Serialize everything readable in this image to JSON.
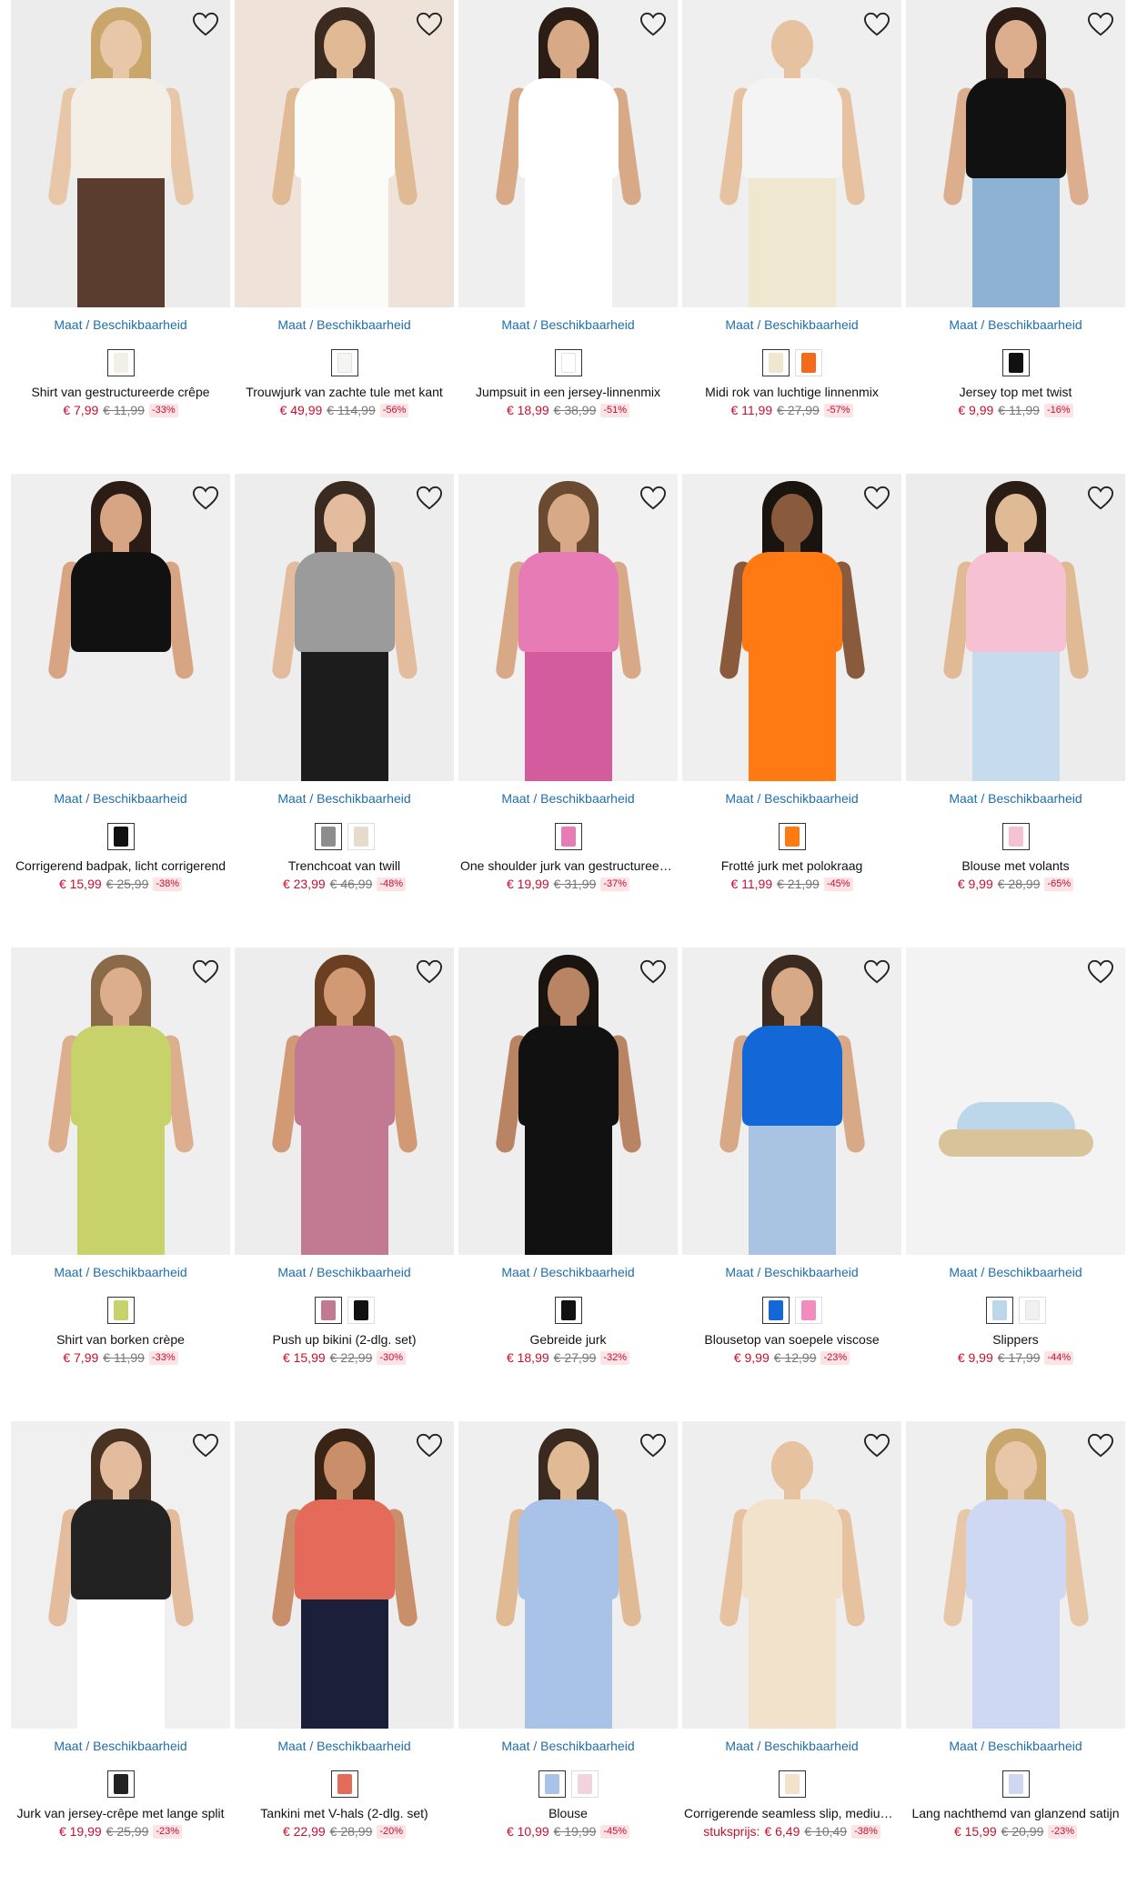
{
  "common": {
    "availability_label": "Maat / Beschikbaarheid"
  },
  "products": [
    {
      "name": "Shirt van gestructureerde crêpe",
      "price": "€ 7,99",
      "old_price": "€ 11,99",
      "discount": "-33%",
      "bg": "#ececec",
      "skin": "#e8c7a8",
      "hair": "#c9a66b",
      "top": "#f3efe6",
      "bottom": "#5a3d2e",
      "swatches": [
        "#f3efe6"
      ]
    },
    {
      "name": "Trouwjurk van zachte tule met kant",
      "price": "€ 49,99",
      "old_price": "€ 114,99",
      "discount": "-56%",
      "bg": "#efe3d9",
      "skin": "#e0b995",
      "hair": "#3a2a20",
      "top": "#fbfbf8",
      "bottom": "#fbfbf8",
      "swatches": [
        "#f5f5f2"
      ]
    },
    {
      "name": "Jumpsuit in een jersey-linnenmix",
      "price": "€ 18,99",
      "old_price": "€ 38,99",
      "discount": "-51%",
      "bg": "#efefef",
      "skin": "#d8a987",
      "hair": "#2b1d16",
      "top": "#ffffff",
      "bottom": "#ffffff",
      "swatches": [
        "#ffffff"
      ]
    },
    {
      "name": "Midi rok van luchtige linnenmix",
      "price": "€ 11,99",
      "old_price": "€ 27,99",
      "discount": "-57%",
      "bg": "#efefef",
      "skin": "#e6c2a1",
      "hair": "#efefef",
      "top": "#f4f4f4",
      "bottom": "#efe7cf",
      "swatches": [
        "#efe7cf",
        "#f26b1d"
      ]
    },
    {
      "name": "Jersey top met twist",
      "price": "€ 9,99",
      "old_price": "€ 11,99",
      "discount": "-16%",
      "bg": "#eeeeee",
      "skin": "#dcae8e",
      "hair": "#2b1d16",
      "top": "#111111",
      "bottom": "#8eb2d4",
      "swatches": [
        "#111111"
      ]
    },
    {
      "name": "Corrigerend badpak, licht corrigerend",
      "price": "€ 15,99",
      "old_price": "€ 25,99",
      "discount": "-38%",
      "bg": "#efefef",
      "skin": "#d7a584",
      "hair": "#2b1d16",
      "top": "#111111",
      "bottom": "#efefef",
      "swatches": [
        "#111111"
      ]
    },
    {
      "name": "Trenchcoat van twill",
      "price": "€ 23,99",
      "old_price": "€ 46,99",
      "discount": "-48%",
      "bg": "#ededed",
      "skin": "#e3bc9d",
      "hair": "#3a2a20",
      "top": "#9b9b9b",
      "bottom": "#1c1c1c",
      "swatches": [
        "#8d8d8d",
        "#e6dccb"
      ]
    },
    {
      "name": "One shoulder jurk van gestructureerde stof",
      "price": "€ 19,99",
      "old_price": "€ 31,99",
      "discount": "-37%",
      "bg": "#f1f1f1",
      "skin": "#d8a987",
      "hair": "#6b4a32",
      "top": "#e77bb5",
      "bottom": "#d35c9e",
      "swatches": [
        "#e77bb5"
      ]
    },
    {
      "name": "Frotté jurk met polokraag",
      "price": "€ 11,99",
      "old_price": "€ 21,99",
      "discount": "-45%",
      "bg": "#efefef",
      "skin": "#8a5a3c",
      "hair": "#1a1410",
      "top": "#ff7a12",
      "bottom": "#ff7a12",
      "swatches": [
        "#ff7a12"
      ]
    },
    {
      "name": "Blouse met volants",
      "price": "€ 9,99",
      "old_price": "€ 28,99",
      "discount": "-65%",
      "bg": "#ececec",
      "skin": "#e0b995",
      "hair": "#2b1d16",
      "top": "#f7c1d4",
      "bottom": "#c6dcee",
      "swatches": [
        "#f7c1d4"
      ]
    },
    {
      "name": "Shirt van borken crèpe",
      "price": "€ 7,99",
      "old_price": "€ 11,99",
      "discount": "-33%",
      "bg": "#efefef",
      "skin": "#dcae8e",
      "hair": "#8a6a48",
      "top": "#c7d36a",
      "bottom": "#c7d36a",
      "swatches": [
        "#c7d36a"
      ]
    },
    {
      "name": "Push up bikini (2-dlg. set)",
      "price": "€ 15,99",
      "old_price": "€ 22,99",
      "discount": "-30%",
      "bg": "#ededed",
      "skin": "#d19a74",
      "hair": "#6b4022",
      "top": "#c27a92",
      "bottom": "#c27a92",
      "swatches": [
        "#c27a92",
        "#111111"
      ]
    },
    {
      "name": "Gebreide jurk",
      "price": "€ 18,99",
      "old_price": "€ 27,99",
      "discount": "-32%",
      "bg": "#eeeeee",
      "skin": "#b88463",
      "hair": "#1a1410",
      "top": "#111111",
      "bottom": "#111111",
      "swatches": [
        "#111111"
      ]
    },
    {
      "name": "Blousetop van soepele viscose",
      "price": "€ 9,99",
      "old_price": "€ 12,99",
      "discount": "-23%",
      "bg": "#efefef",
      "skin": "#d8a987",
      "hair": "#3a2a20",
      "top": "#1367d6",
      "bottom": "#a8c4e2",
      "swatches": [
        "#1367d6",
        "#f28cc0"
      ]
    },
    {
      "name": "Slippers",
      "price": "€ 9,99",
      "old_price": "€ 17,99",
      "discount": "-44%",
      "bg": "#f3f3f3",
      "skin": "#f3f3f3",
      "hair": "#f3f3f3",
      "top": "#f3f3f3",
      "bottom": "#f3f3f3",
      "swatches": [
        "#bcd6ea",
        "#f0f0f0"
      ]
    },
    {
      "name": "Jurk van jersey-crêpe met lange split",
      "price": "€ 19,99",
      "old_price": "€ 25,99",
      "discount": "-23%",
      "bg": "#f0f0f0",
      "skin": "#e3bc9d",
      "hair": "#4a3222",
      "top": "#222222",
      "bottom": "#ffffff",
      "swatches": [
        "#222222"
      ]
    },
    {
      "name": "Tankini met V-hals (2-dlg. set)",
      "price": "€ 22,99",
      "old_price": "€ 28,99",
      "discount": "-20%",
      "bg": "#ededed",
      "skin": "#c98f6a",
      "hair": "#3a2416",
      "top": "#e46a5a",
      "bottom": "#1c1f3a",
      "swatches": [
        "#e46a5a"
      ]
    },
    {
      "name": "Blouse",
      "price": "€ 10,99",
      "old_price": "€ 19,99",
      "discount": "-45%",
      "bg": "#efefef",
      "skin": "#e0b995",
      "hair": "#3a2a20",
      "top": "#a9c3e8",
      "bottom": "#a9c3e8",
      "swatches": [
        "#a9c3e8",
        "#f3d4de"
      ]
    },
    {
      "name": "Corrigerende seamless slip, medium corrigerend",
      "price_label": "stuksprijs:",
      "price": "€ 6,49",
      "old_price": "€ 10,49",
      "discount": "-38%",
      "bg": "#eeeeee",
      "skin": "#e6c2a1",
      "hair": "#eeeeee",
      "top": "#f2e2cc",
      "bottom": "#f2e2cc",
      "swatches": [
        "#f2e2cc"
      ]
    },
    {
      "name": "Lang nachthemd van glanzend satijn",
      "price": "€ 15,99",
      "old_price": "€ 20,99",
      "discount": "-23%",
      "bg": "#efefef",
      "skin": "#e8c7a8",
      "hair": "#c9a66b",
      "top": "#cfd8f2",
      "bottom": "#cfd8f2",
      "swatches": [
        "#cfd8f2"
      ]
    }
  ]
}
